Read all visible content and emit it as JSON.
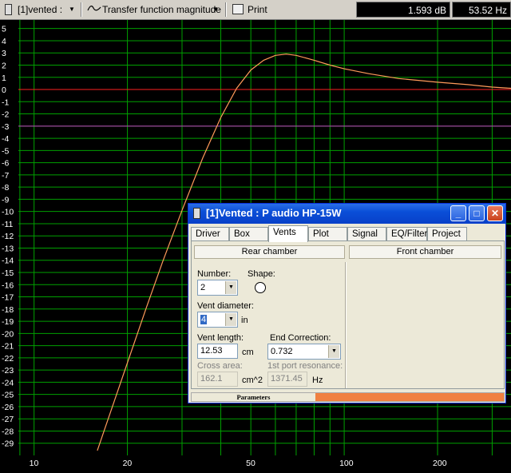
{
  "toolbar": {
    "graph_selector": "[1]vented :",
    "view_selector": "Transfer function magnitude",
    "print_label": "Print",
    "readout_db": "1.593 dB",
    "readout_hz": "53.52 Hz"
  },
  "chart_data": {
    "type": "line",
    "xscale": "log",
    "x_ticks": [
      10,
      20,
      50,
      100,
      200
    ],
    "y_ticks": [
      5,
      4,
      3,
      2,
      1,
      0,
      -1,
      -2,
      -3,
      -4,
      -5,
      -6,
      -7,
      -8,
      -9,
      -10,
      -11,
      -12,
      -13,
      -14,
      -15,
      -16,
      -17,
      -18,
      -19,
      -20,
      -21,
      -22,
      -23,
      -24,
      -25,
      -26,
      -27,
      -28,
      -29
    ],
    "xlim": [
      8.9,
      345
    ],
    "ylim": [
      -30,
      5.7
    ],
    "reference_lines": [
      {
        "y": 0,
        "color": "#ff2020"
      },
      {
        "y": -3,
        "color": "#c040c0"
      }
    ],
    "grid": true,
    "grid_color": "#00a000",
    "series": [
      {
        "color": "#ff9a5a",
        "x": [
          16,
          18,
          20,
          23,
          26,
          30,
          35,
          40,
          45,
          50,
          55,
          60,
          65,
          70,
          80,
          90,
          100,
          120,
          150,
          200,
          250,
          300,
          345
        ],
        "y": [
          -29.6,
          -25.8,
          -22.4,
          -17.9,
          -14.1,
          -9.9,
          -5.6,
          -2.3,
          0.1,
          1.6,
          2.4,
          2.8,
          2.9,
          2.8,
          2.4,
          2.0,
          1.7,
          1.3,
          0.9,
          0.6,
          0.4,
          0.2,
          0.1
        ]
      }
    ]
  },
  "dialog": {
    "title": "[1]Vented : P audio HP-15W",
    "tabs": [
      "Driver",
      "Box",
      "Vents",
      "Plot",
      "Signal",
      "EQ/Filter",
      "Project"
    ],
    "active_tab": "Vents",
    "rear_chamber_label": "Rear chamber",
    "front_chamber_label": "Front chamber",
    "number_label": "Number:",
    "number_value": "2",
    "shape_label": "Shape:",
    "vent_diameter_label": "Vent diameter:",
    "vent_diameter_value": "4",
    "vent_diameter_unit": "in",
    "vent_length_label": "Vent length:",
    "vent_length_value": "12.53",
    "vent_length_unit": "cm",
    "end_correction_label": "End Correction:",
    "end_correction_value": "0.732",
    "cross_area_label": "Cross area:",
    "cross_area_value": "162.1",
    "cross_area_unit": "cm^2",
    "port_resonance_label": "1st port resonance:",
    "port_resonance_value": "1371.45",
    "port_resonance_unit": "Hz",
    "status_parameters": "Parameters"
  }
}
